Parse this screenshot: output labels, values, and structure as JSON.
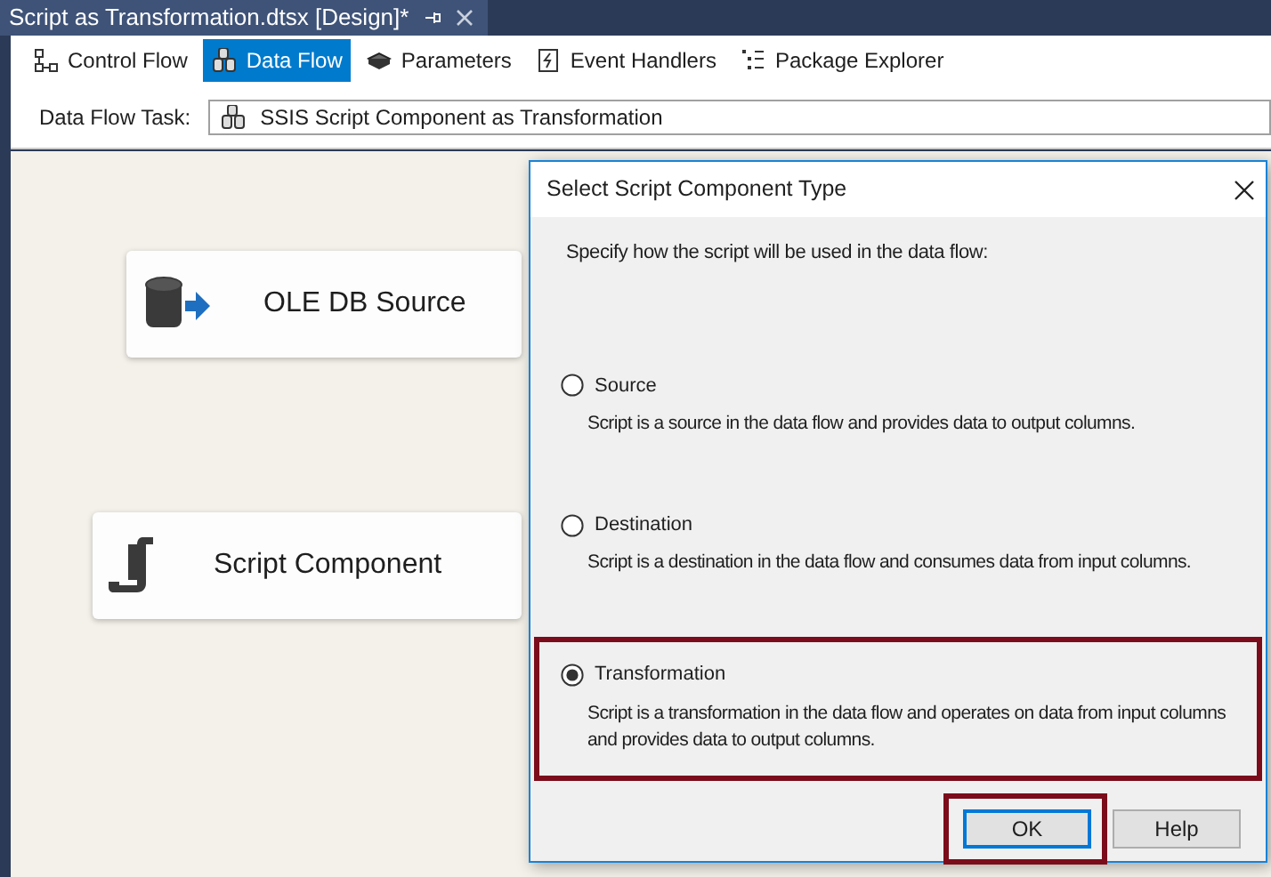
{
  "document_tab": {
    "title": "Script as Transformation.dtsx [Design]*"
  },
  "designer_tabs": [
    {
      "label": "Control Flow",
      "selected": false
    },
    {
      "label": "Data Flow",
      "selected": true
    },
    {
      "label": "Parameters",
      "selected": false
    },
    {
      "label": "Event Handlers",
      "selected": false
    },
    {
      "label": "Package Explorer",
      "selected": false
    }
  ],
  "task": {
    "label": "Data Flow Task:",
    "value": "SSIS Script Component as Transformation"
  },
  "canvas_nodes": [
    {
      "kind": "source",
      "label": "OLE DB Source"
    },
    {
      "kind": "script",
      "label": "Script Component"
    }
  ],
  "dialog": {
    "title": "Select Script Component Type",
    "prompt": "Specify how the script will be used in the data flow:",
    "options": [
      {
        "label": "Source",
        "description": "Script is a source in the data flow and provides data to output columns.",
        "selected": false,
        "annotated": false
      },
      {
        "label": "Destination",
        "description": "Script is a destination in the data flow and consumes data from input columns.",
        "selected": false,
        "annotated": false
      },
      {
        "label": "Transformation",
        "description": "Script is a transformation in the data flow and operates on data from input columns and provides data to output columns.",
        "selected": true,
        "annotated": true
      }
    ],
    "buttons": [
      {
        "label": "OK",
        "focused": true,
        "annotated": true
      },
      {
        "label": "Help",
        "focused": false,
        "annotated": false
      }
    ]
  }
}
